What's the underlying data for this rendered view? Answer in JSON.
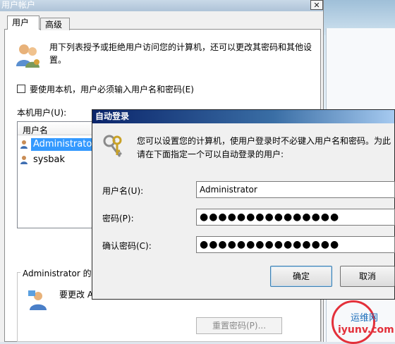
{
  "main_window": {
    "title": "用户帐户",
    "close_glyph": "✕",
    "tabs": [
      "用户",
      "高级"
    ],
    "intro": "用下列表授予或拒绝用户访问您的计算机，还可以更改其密码和其他设置。",
    "must_enter_label": "要使用本机，用户必须输入用户名和密码(E)",
    "local_users_label": "本机用户(U):",
    "column_username": "用户名",
    "users": [
      "Administrator",
      "sysbak"
    ],
    "group_legend": "Administrator 的密",
    "change_pwd_text": "要更改 A",
    "reset_button": "重置密码(P)..."
  },
  "dialog": {
    "title": "自动登录",
    "description": "您可以设置您的计算机，使用户登录时不必键入用户名和密码。为此请在下面指定一个可以自动登录的用户:",
    "username_label": "用户名(U):",
    "password_label": "密码(P):",
    "confirm_label": "确认密码(C):",
    "username_value": "Administrator",
    "password_value": "●●●●●●●●●●●●●●●",
    "confirm_value": "●●●●●●●●●●●●●●●",
    "ok_label": "确定",
    "cancel_label": "取消"
  },
  "watermark": {
    "top": "运维网",
    "bottom": "iyunv.com"
  },
  "colors": {
    "selection": "#3399ff",
    "dialog_title": "#0a246a",
    "watermark_red": "#e3303a"
  }
}
